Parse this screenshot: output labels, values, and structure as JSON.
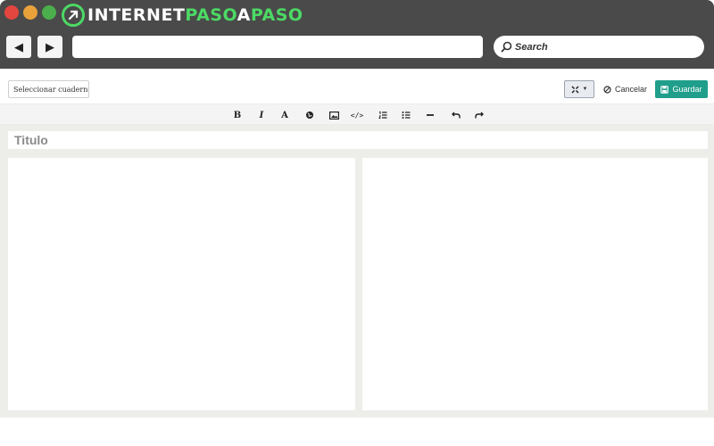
{
  "browser": {
    "logo": {
      "part1": "INTERNET",
      "part2": "PASO",
      "part3": "A",
      "part4": "PASO"
    },
    "nav": {
      "back_symbol": "◀",
      "forward_symbol": "▶"
    },
    "search": {
      "text": "Search"
    }
  },
  "toolbar": {
    "notebook_select": "Seleccionar cuaderno",
    "cancel_label": "Cancelar",
    "save_label": "Guardar"
  },
  "format_toolbar": {
    "bold": "B",
    "italic": "I",
    "font": "A",
    "link": "link-icon",
    "image": "image-icon",
    "code": "</>",
    "ordered_list": "ordered-list-icon",
    "unordered_list": "unordered-list-icon",
    "horizontal_rule": "horizontal-rule-icon",
    "undo": "undo-icon",
    "redo": "redo-icon"
  },
  "editor": {
    "title_placeholder": "Titulo"
  },
  "colors": {
    "chrome": "#4a4a4a",
    "logo_green": "#4cd964",
    "save_button": "#1f9e8b",
    "editor_background": "#ededea"
  }
}
